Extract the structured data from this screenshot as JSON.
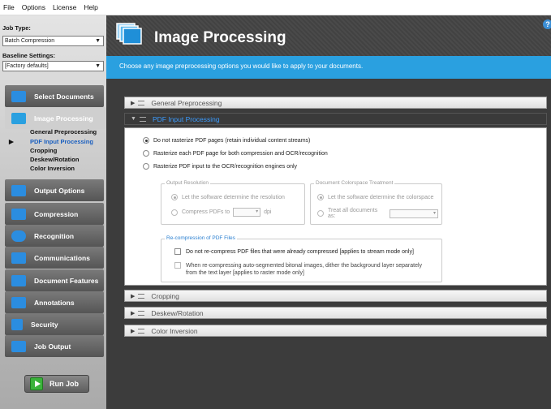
{
  "menu": [
    "File",
    "Options",
    "License",
    "Help"
  ],
  "sidebar": {
    "job_type_label": "Job Type:",
    "job_type_value": "Batch Compression",
    "baseline_label": "Baseline Settings:",
    "baseline_value": "[Factory defaults]",
    "nav": [
      "Select Documents",
      "Image Processing",
      "Output Options",
      "Compression",
      "Recognition",
      "Communications",
      "Document Features",
      "Annotations",
      "Security",
      "Job Output"
    ],
    "sub": [
      "General Preprocessing",
      "PDF Input Processing",
      "Cropping",
      "Deskew/Rotation",
      "Color Inversion"
    ],
    "run": "Run Job"
  },
  "header": {
    "title": "Image Processing",
    "help": "?"
  },
  "banner": "Choose any image preprocessing options you would like to apply to your documents.",
  "sections": {
    "general": "General Preprocessing",
    "pdf": "PDF Input Processing",
    "cropping": "Cropping",
    "deskew": "Deskew/Rotation",
    "color": "Color Inversion"
  },
  "pdf": {
    "r1": "Do not rasterize PDF pages (retain individual content streams)",
    "r2": "Rasterize each PDF page for both compression and OCR/recognition",
    "r3": "Rasterize PDF input to the OCR/recognition engines only",
    "out_res": "Output Resolution",
    "out_r1": "Let the software determine the resolution",
    "out_r2": "Compress PDFs to",
    "dpi": "dpi",
    "cs": "Document Colorspace Treatment",
    "cs_r1": "Let the software determine the colorspace",
    "cs_r2": "Treat all documents as:",
    "recomp": "Re-compression of PDF Files",
    "c1": "Do not re-compress PDF files that were already compressed [applies to stream mode only]",
    "c2a": "When re-compressing auto-segmented bitonal images, dither the background layer separately",
    "c2b": "from the text layer [applies to raster mode only]"
  },
  "colors": {
    "accent": "#2aa0e0",
    "link": "#3b9cff"
  }
}
